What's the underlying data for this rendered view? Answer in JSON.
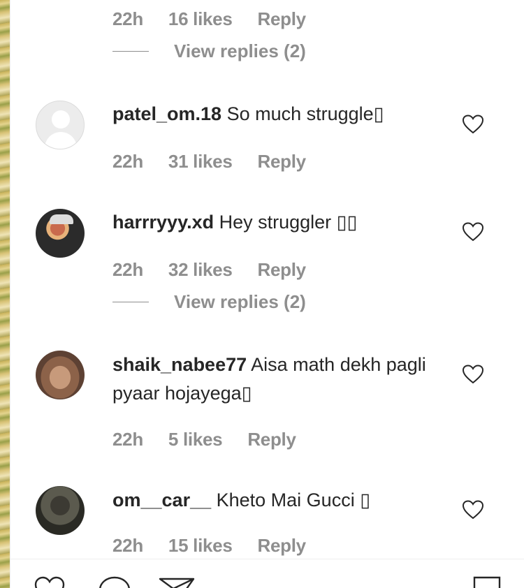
{
  "top_comment": {
    "time": "22h",
    "likes": "16 likes",
    "reply": "Reply",
    "view_replies": "View replies (2)"
  },
  "comments": [
    {
      "username": "patel_om.18",
      "text": " So much struggle▯",
      "time": "22h",
      "likes": "31 likes",
      "reply": "Reply"
    },
    {
      "username": "harrryyy.xd",
      "text": " Hey struggler ▯▯",
      "time": "22h",
      "likes": "32 likes",
      "reply": "Reply",
      "view_replies": "View replies (2)"
    },
    {
      "username": "shaik_nabee77",
      "text": " Aisa math dekh pagli pyaar hojayega▯",
      "time": "22h",
      "likes": "5 likes",
      "reply": "Reply"
    },
    {
      "username": "om__car__",
      "text": " Kheto Mai Gucci ▯",
      "time": "22h",
      "likes": "15 likes",
      "reply": "Reply"
    }
  ],
  "icons": {
    "like": "heart-icon",
    "comment": "comment-icon",
    "share": "share-icon",
    "save": "bookmark-icon"
  },
  "colors": {
    "text": "#262626",
    "secondary": "#8e8e8e",
    "divider": "#efefef"
  }
}
